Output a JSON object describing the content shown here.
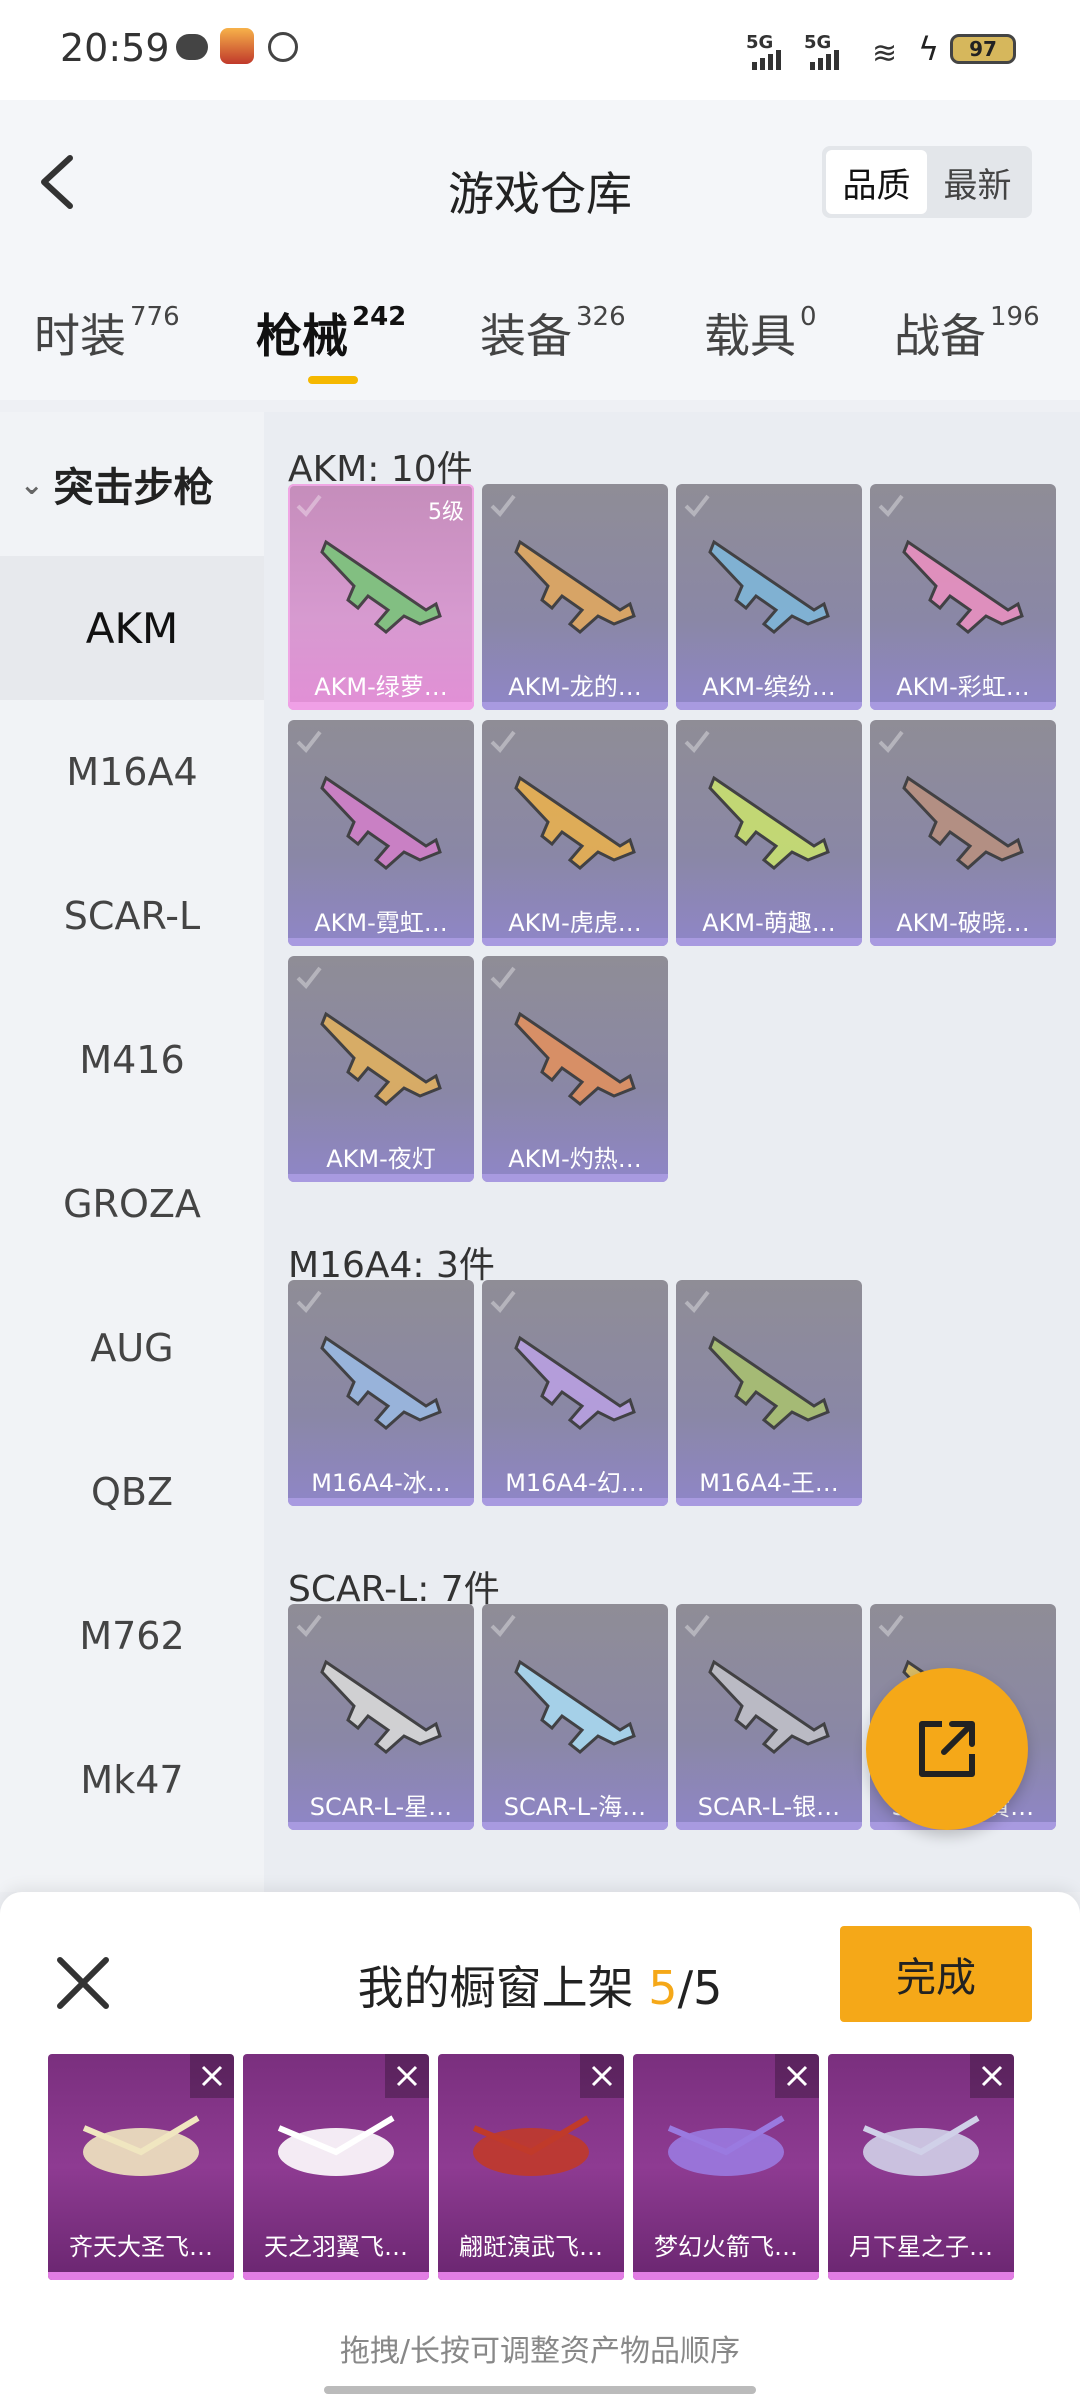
{
  "status_bar": {
    "time": "20:59",
    "network_1": "5G",
    "network_2": "5G",
    "battery": "97"
  },
  "header": {
    "title": "游戏仓库",
    "sort_options": [
      "品质",
      "最新"
    ],
    "sort_selected": "品质"
  },
  "tabs": [
    {
      "label": "时装",
      "count": "776"
    },
    {
      "label": "枪械",
      "count": "242"
    },
    {
      "label": "装备",
      "count": "326"
    },
    {
      "label": "载具",
      "count": "0"
    },
    {
      "label": "战备",
      "count": "196"
    }
  ],
  "sidebar": {
    "category": "突击步枪",
    "items": [
      "AKM",
      "M16A4",
      "SCAR-L",
      "M416",
      "GROZA",
      "AUG",
      "QBZ",
      "M762",
      "Mk47"
    ]
  },
  "sections": [
    {
      "title": "AKM: 10件",
      "items": [
        {
          "name": "AKM-绿萝…",
          "level": "5级"
        },
        {
          "name": "AKM-龙的…"
        },
        {
          "name": "AKM-缤纷…"
        },
        {
          "name": "AKM-彩虹…"
        },
        {
          "name": "AKM-霓虹…"
        },
        {
          "name": "AKM-虎虎…"
        },
        {
          "name": "AKM-萌趣…"
        },
        {
          "name": "AKM-破晓…"
        },
        {
          "name": "AKM-夜灯"
        },
        {
          "name": "AKM-灼热…"
        }
      ]
    },
    {
      "title": "M16A4: 3件",
      "items": [
        {
          "name": "M16A4-冰…"
        },
        {
          "name": "M16A4-幻…"
        },
        {
          "name": "M16A4-王…"
        }
      ]
    },
    {
      "title": "SCAR-L: 7件",
      "items": [
        {
          "name": "SCAR-L-星…"
        },
        {
          "name": "SCAR-L-海…"
        },
        {
          "name": "SCAR-L-银…"
        },
        {
          "name": "SCAR-L-黄…"
        }
      ]
    }
  ],
  "showcase": {
    "title_prefix": "我的橱窗上架",
    "count": "5",
    "separator": "/",
    "total": "5",
    "done_label": "完成",
    "items": [
      "齐天大圣飞…",
      "天之羽翼飞…",
      "翩跹演武飞…",
      "梦幻火箭飞…",
      "月下星之子…"
    ],
    "hint": "拖拽/长按可调整资产物品顺序"
  },
  "colors": {
    "accent": "#f5a818",
    "card_purple": "#8f86c8",
    "card_pink": "#e28fd6",
    "showcase_slot": "#8e3b92"
  }
}
